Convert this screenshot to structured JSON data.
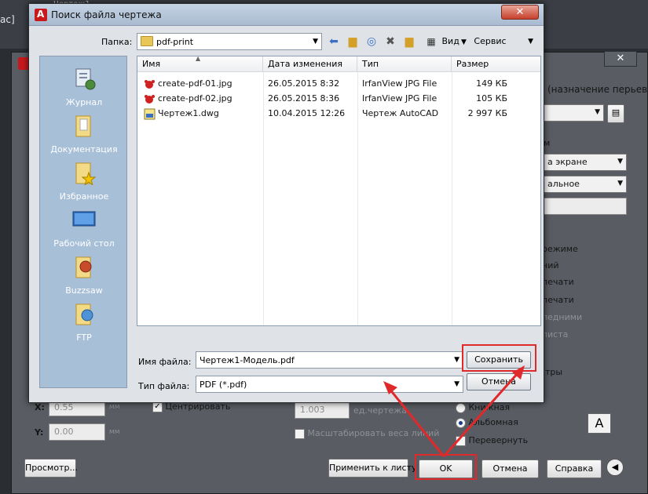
{
  "background_app": {
    "window_text": "ac]",
    "window_title": "Чертеж1",
    "close_glyph": "✕",
    "right_panel": {
      "plot_style_label": "(назначение перьев)",
      "items": [
        "а экране",
        "альное"
      ],
      "options": [
        "режиме",
        "ний",
        "печати",
        "печати",
        "ледними",
        "листа"
      ],
      "options_dim": [
        false,
        false,
        false,
        false,
        true,
        true
      ],
      "last_option": "тры",
      "section_label": "м"
    },
    "offset": {
      "x_label": "X:",
      "x_value": "0.55",
      "x_unit": "мм",
      "y_label": "Y:",
      "y_value": "0.00",
      "y_unit": "мм",
      "center_label": "Центрировать"
    },
    "scale": {
      "value": "1.003",
      "unit": "ед.чертежа",
      "lineweight_label": "Масштабировать веса линий"
    },
    "orientation": {
      "portrait": "Книжная",
      "landscape": "Альбомная",
      "flip": "Перевернуть",
      "letter": "A"
    },
    "buttons": {
      "preview": "Просмотр...",
      "apply": "Применить к листу",
      "ok": "OK",
      "cancel": "Отмена",
      "help": "Справка",
      "collapse": "◀"
    }
  },
  "dialog": {
    "title": "Поиск файла чертежа",
    "close_glyph": "✕",
    "folder_label": "Папка:",
    "folder_value": "pdf-print",
    "views_label": "Вид",
    "tools_label": "Сервис",
    "places": [
      {
        "label": "Журнал",
        "icon": "history-icon"
      },
      {
        "label": "Документация",
        "icon": "documents-folder-icon"
      },
      {
        "label": "Избранное",
        "icon": "favorites-folder-icon"
      },
      {
        "label": "Рабочий стол",
        "icon": "desktop-icon"
      },
      {
        "label": "Buzzsaw",
        "icon": "buzzsaw-icon"
      },
      {
        "label": "FTP",
        "icon": "ftp-icon"
      }
    ],
    "columns": {
      "name": "Имя",
      "date": "Дата изменения",
      "type": "Тип",
      "size": "Размер"
    },
    "files": [
      {
        "name": "create-pdf-01.jpg",
        "date": "26.05.2015 8:32",
        "type": "IrfanView JPG File",
        "size": "149 КБ",
        "icon": "irfanview-file-icon"
      },
      {
        "name": "create-pdf-02.jpg",
        "date": "26.05.2015 8:36",
        "type": "IrfanView JPG File",
        "size": "105 КБ",
        "icon": "irfanview-file-icon"
      },
      {
        "name": "Чертеж1.dwg",
        "date": "10.04.2015 12:26",
        "type": "Чертеж AutoCAD",
        "size": "2 997 КБ",
        "icon": "dwg-file-icon"
      }
    ],
    "filename_label": "Имя файла:",
    "filename_value": "Чертеж1-Модель.pdf",
    "filetype_label": "Тип файла:",
    "filetype_value": "PDF (*.pdf)",
    "save_button": "Сохранить",
    "cancel_button": "Отмена"
  },
  "colors": {
    "highlight_red": "#e0292b"
  }
}
